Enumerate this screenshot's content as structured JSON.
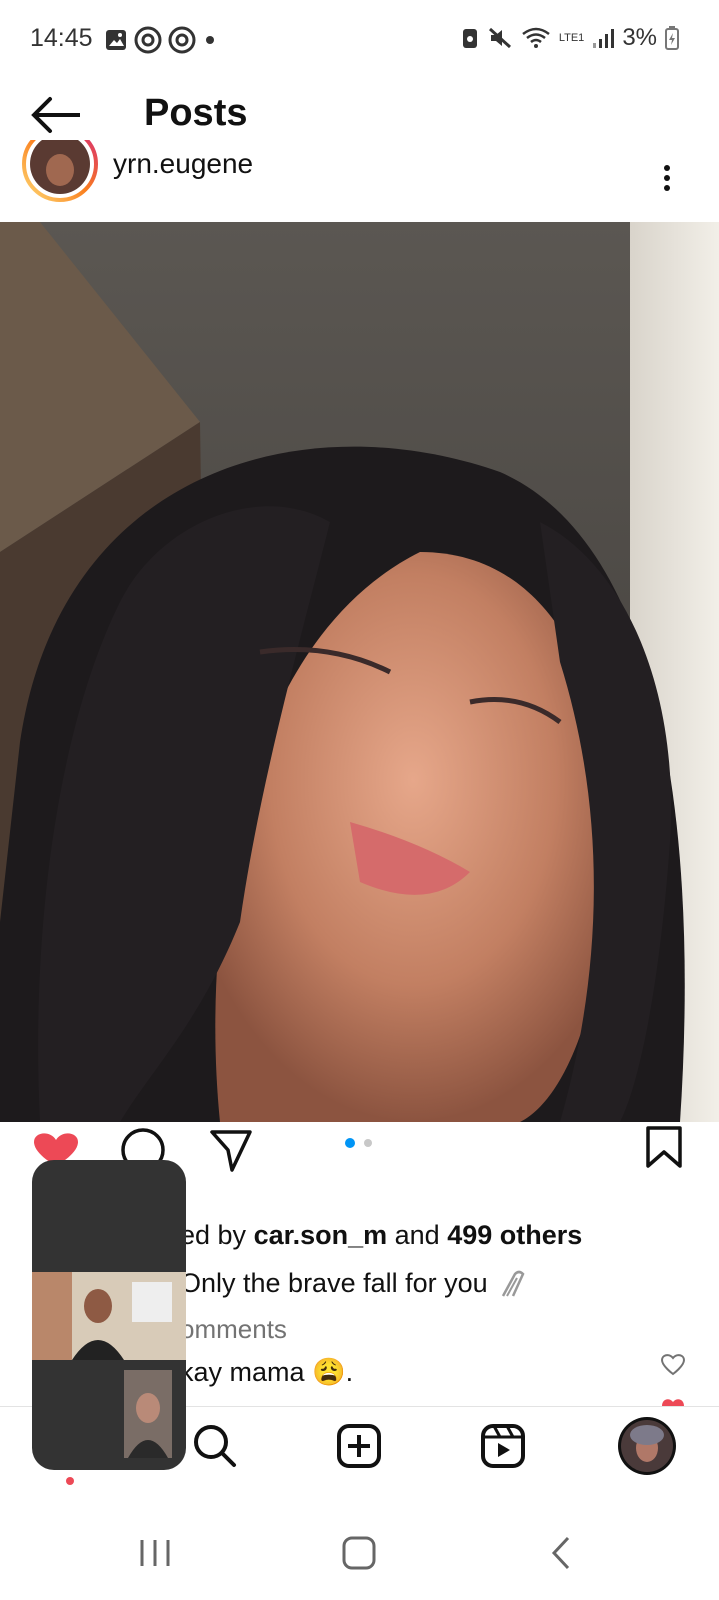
{
  "status_bar": {
    "time": "14:45",
    "battery": "3%",
    "network": "LTE1"
  },
  "header": {
    "title": "Posts"
  },
  "post": {
    "username": "yrn.eugene",
    "pagination_dots": 2,
    "likes_text": "ed by ",
    "liked_user": "car.son_m",
    "likes_mid": " and ",
    "likes_others": "499 others",
    "caption": "Only the brave fall for you",
    "comments_link": "omments",
    "comment_text": "kay mama 😩."
  },
  "colors": {
    "like_red": "#ed4956",
    "accent_blue": "#0095f6",
    "muted": "#737373"
  }
}
